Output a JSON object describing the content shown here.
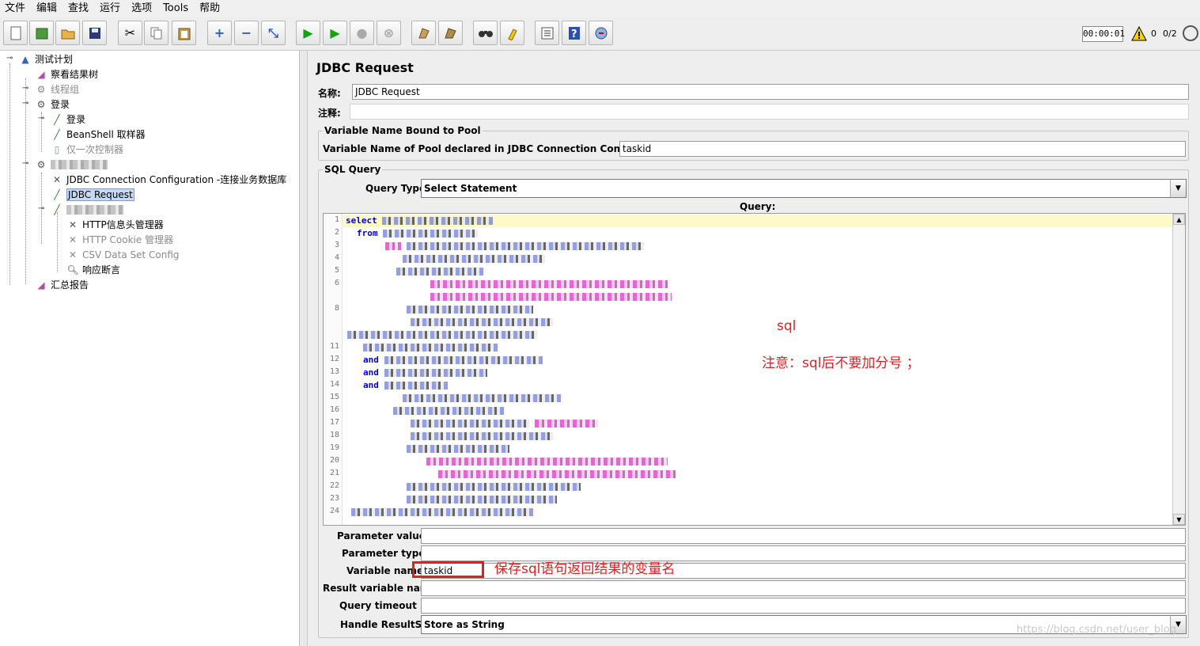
{
  "menu": [
    "文件",
    "编辑",
    "查找",
    "运行",
    "选项",
    "Tools",
    "帮助"
  ],
  "toolbar": {
    "timer": "00:00:01",
    "warnings": "0",
    "threads": "0/2"
  },
  "tree": {
    "test_plan": "测试计划",
    "view_results_tree": "察看结果树",
    "thread_group": "线程组",
    "login_group": "登录",
    "login_sampler": "登录",
    "beanshell": "BeanShell 取样器",
    "once_only": "仅一次控制器",
    "jdbc_config": "JDBC Connection Configuration -连接业务数据库",
    "jdbc_request": "JDBC Request",
    "http_header": "HTTP信息头管理器",
    "http_cookie": "HTTP Cookie 管理器",
    "csv_config": "CSV Data Set Config",
    "response_assert": "响应断言",
    "summary_report": "汇总报告"
  },
  "panel": {
    "title": "JDBC Request",
    "name_label": "名称:",
    "name_value": "JDBC Request",
    "comment_label": "注释:",
    "pool_group": "Variable Name Bound to Pool",
    "pool_label": "Variable Name of Pool declared in JDBC Connection Configuration:",
    "pool_value": "taskid",
    "sql_group": "SQL Query",
    "query_type_label": "Query Type:",
    "query_type_value": "Select Statement",
    "query_label": "Query:",
    "param_values_label": "Parameter values:",
    "param_types_label": "Parameter types:",
    "variable_names_label": "Variable names:",
    "variable_names_value": "taskid",
    "result_var_label": "Result variable name:",
    "timeout_label": "Query timeout (s):",
    "resultset_label": "Handle ResultSet:",
    "resultset_value": "Store as String"
  },
  "code": {
    "l1": "select",
    "l2": "from",
    "l12": "and",
    "l13": "and",
    "l14": "and"
  },
  "annotations": {
    "sql": "sql",
    "note": "注意：sql后不要加分号 ；",
    "varname": "保存sql语句返回结果的变量名"
  },
  "watermark": "https://blog.csdn.net/user_blog",
  "colors": {
    "annotation": "#e02020",
    "selection": "#c6d9f0",
    "keyword": "#0000cc"
  }
}
